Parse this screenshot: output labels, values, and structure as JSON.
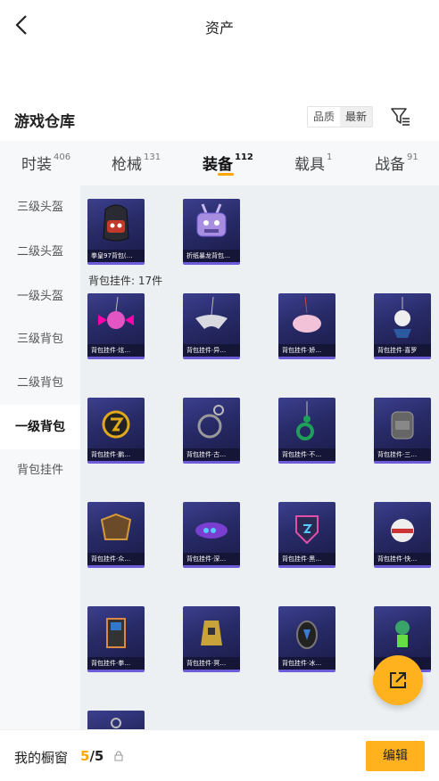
{
  "header": {
    "title": "资产"
  },
  "warehouse": {
    "title": "游戏仓库",
    "sort_options": [
      "品质",
      "最新"
    ],
    "selected_sort": "最新",
    "filter_icon": "filter-icon"
  },
  "tabs": [
    {
      "label": "时装",
      "count": "406"
    },
    {
      "label": "枪械",
      "count": "131"
    },
    {
      "label": "装备",
      "count": "112"
    },
    {
      "label": "载具",
      "count": "1"
    },
    {
      "label": "战备",
      "count": "91"
    }
  ],
  "active_tab": "装备",
  "sidebar": {
    "items": [
      "三级头盔",
      "二级头盔",
      "一级头盔",
      "三级背包",
      "二级背包",
      "一级背包",
      "背包挂件"
    ],
    "active": "一级背包"
  },
  "backpacks": [
    {
      "name": "拳皇97背包(…"
    },
    {
      "name": "折纸暴龙背包…"
    }
  ],
  "pendant_group": {
    "label": "背包挂件: 17件"
  },
  "pendants": [
    {
      "name": "背包挂件·炫…"
    },
    {
      "name": "背包挂件·异…"
    },
    {
      "name": "背包挂件·娇…"
    },
    {
      "name": "背包挂件·喜罗"
    },
    {
      "name": "背包挂件·鹏…"
    },
    {
      "name": "背包挂件·古…"
    },
    {
      "name": "背包挂件·不…"
    },
    {
      "name": "背包挂件·三…"
    },
    {
      "name": "背包挂件·众…"
    },
    {
      "name": "背包挂件·深…"
    },
    {
      "name": "背包挂件·黑…"
    },
    {
      "name": "背包挂件·快…"
    },
    {
      "name": "背包挂件·拳…"
    },
    {
      "name": "背包挂件·冥…"
    },
    {
      "name": "背包挂件·冰…"
    },
    {
      "name": ""
    },
    {
      "name": ""
    }
  ],
  "footer": {
    "showcase_label": "我的橱窗",
    "showcase_current": "5",
    "showcase_separator": "/",
    "showcase_total": "5",
    "edit_label": "编辑"
  },
  "colors": {
    "accent": "#ffb21e",
    "tab_accent": "#ffa500",
    "card_border": "#6e5bd8"
  }
}
